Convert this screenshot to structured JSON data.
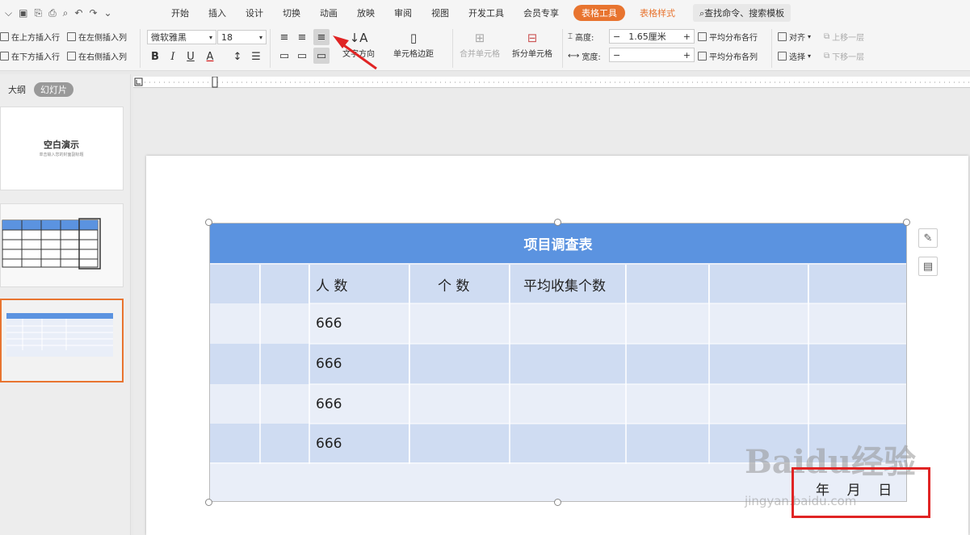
{
  "titlebar": {
    "tabs": [
      "开始",
      "插入",
      "设计",
      "切换",
      "动画",
      "放映",
      "审阅",
      "视图",
      "开发工具",
      "会员专享"
    ],
    "active_tab": "表格工具",
    "style_tab": "表格样式",
    "search_placeholder": "查找命令、搜索模板"
  },
  "ribbon": {
    "insert_above": "在上方插入行",
    "insert_left": "在左侧插入列",
    "insert_below": "在下方插入行",
    "insert_right": "在右侧插入列",
    "font_name": "微软雅黑",
    "font_size": "18",
    "text_direction": "文字方向",
    "cell_margin": "单元格边距",
    "merge_cells": "合并单元格",
    "split_cells": "拆分单元格",
    "height_label": "高度:",
    "height_value": "1.65厘米",
    "width_label": "宽度:",
    "width_value": "",
    "distribute_rows": "平均分布各行",
    "distribute_cols": "平均分布各列",
    "align": "对齐",
    "select": "选择",
    "bring_forward": "上移一层",
    "send_backward": "下移一层",
    "bold": "B",
    "italic": "I",
    "underline": "U",
    "font_color": "A"
  },
  "left_panel": {
    "outline_tab": "大纲",
    "slides_tab": "幻灯片",
    "slide1_title": "空白演示",
    "slide1_subtitle": "单击输入您的封面副标题"
  },
  "table": {
    "title": "项目调查表",
    "headers": [
      "人  数",
      "个  数",
      "平均收集个数"
    ],
    "rows": [
      "666",
      "666",
      "666",
      "666"
    ],
    "footer": "年    月    日"
  },
  "watermark": {
    "brand": "Baidu经验",
    "url": "jingyan.baidu.com"
  },
  "colors": {
    "table_header": "#5b93e0",
    "accent": "#e8742f",
    "highlight": "#e02424"
  }
}
